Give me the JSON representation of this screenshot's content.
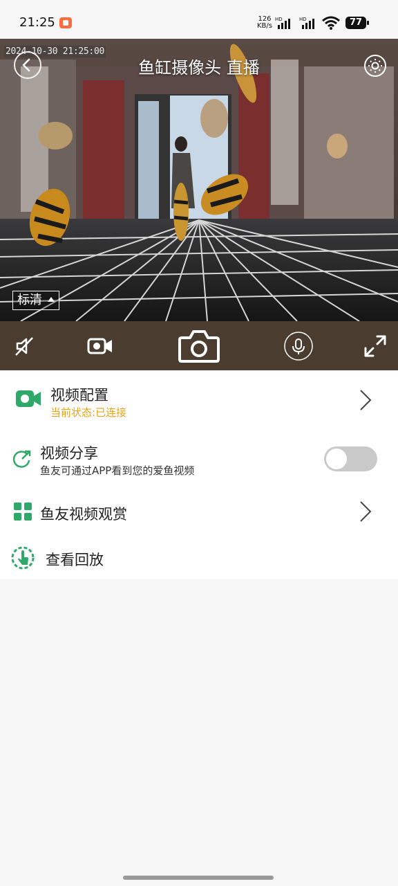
{
  "status_bar": {
    "time": "21:25",
    "net_speed_value": "126",
    "net_speed_unit": "KB/s",
    "hd_label": "HD",
    "battery": "77"
  },
  "video": {
    "timestamp": "2024-10-30 21:25:00",
    "title": "鱼缸摄像头 直播",
    "quality": "标清",
    "back_icon": "chevron-left-icon",
    "settings_icon": "gear-icon"
  },
  "controls": [
    {
      "name": "mute-button",
      "icon": "speaker-mute-icon"
    },
    {
      "name": "record-button",
      "icon": "video-camera-icon"
    },
    {
      "name": "snapshot-button",
      "icon": "camera-icon"
    },
    {
      "name": "talk-button",
      "icon": "microphone-icon"
    },
    {
      "name": "fullscreen-button",
      "icon": "expand-icon"
    }
  ],
  "menu": {
    "video_config": {
      "label": "视频配置",
      "status": "当前状态:已连接",
      "status_color": "#e8a317"
    },
    "video_share": {
      "label": "视频分享",
      "desc": "鱼友可通过APP看到您的爱鱼视频",
      "enabled": false
    },
    "fish_videos": {
      "label": "鱼友视频观赏"
    },
    "playback": {
      "label": "查看回放"
    }
  },
  "colors": {
    "accent_green": "#2fa96a",
    "control_bar": "#4a3d30",
    "status_orange": "#e8a317"
  }
}
